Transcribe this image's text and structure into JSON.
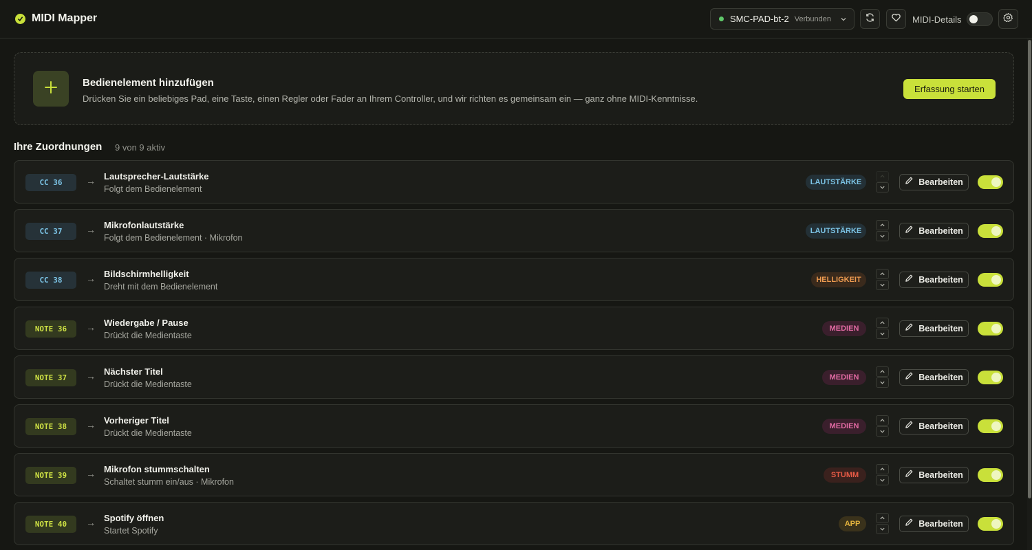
{
  "header": {
    "app_title": "MIDI Mapper",
    "device_name": "SMC-PAD-bt-2",
    "device_status": "Verbunden",
    "midi_details_label": "MIDI-Details",
    "midi_details_on": false
  },
  "add_card": {
    "title": "Bedienelement hinzufügen",
    "description": "Drücken Sie ein beliebiges Pad, eine Taste, einen Regler oder Fader an Ihrem Controller, und wir richten es gemeinsam ein — ganz ohne MIDI-Kenntnisse.",
    "button_label": "Erfassung starten"
  },
  "mappings": {
    "title": "Ihre Zuordnungen",
    "count_label": "9 von 9 aktiv",
    "edit_label": "Bearbeiten",
    "rows": [
      {
        "code": "CC 36",
        "kind": "cc",
        "title": "Lautsprecher-Lautstärke",
        "subtitle": "Folgt dem Bedienelement",
        "badge": "LAUTSTÄRKE",
        "badge_kind": "laut",
        "enabled": true
      },
      {
        "code": "CC 37",
        "kind": "cc",
        "title": "Mikrofonlautstärke",
        "subtitle": "Folgt dem Bedienelement · Mikrofon",
        "badge": "LAUTSTÄRKE",
        "badge_kind": "laut",
        "enabled": true
      },
      {
        "code": "CC 38",
        "kind": "cc",
        "title": "Bildschirmhelligkeit",
        "subtitle": "Dreht mit dem Bedienelement",
        "badge": "HELLIGKEIT",
        "badge_kind": "hell",
        "enabled": true
      },
      {
        "code": "NOTE 36",
        "kind": "note",
        "title": "Wiedergabe / Pause",
        "subtitle": "Drückt die Medientaste",
        "badge": "MEDIEN",
        "badge_kind": "med",
        "enabled": true
      },
      {
        "code": "NOTE 37",
        "kind": "note",
        "title": "Nächster Titel",
        "subtitle": "Drückt die Medientaste",
        "badge": "MEDIEN",
        "badge_kind": "med",
        "enabled": true
      },
      {
        "code": "NOTE 38",
        "kind": "note",
        "title": "Vorheriger Titel",
        "subtitle": "Drückt die Medientaste",
        "badge": "MEDIEN",
        "badge_kind": "med",
        "enabled": true
      },
      {
        "code": "NOTE 39",
        "kind": "note",
        "title": "Mikrofon stummschalten",
        "subtitle": "Schaltet stumm ein/aus · Mikrofon",
        "badge": "STUMM",
        "badge_kind": "stumm",
        "enabled": true
      },
      {
        "code": "NOTE 40",
        "kind": "note",
        "title": "Spotify öffnen",
        "subtitle": "Startet Spotify",
        "badge": "APP",
        "badge_kind": "app",
        "enabled": true
      }
    ]
  },
  "colors": {
    "accent": "#c9e03a",
    "background": "#161713",
    "connected": "#5fc86a"
  }
}
